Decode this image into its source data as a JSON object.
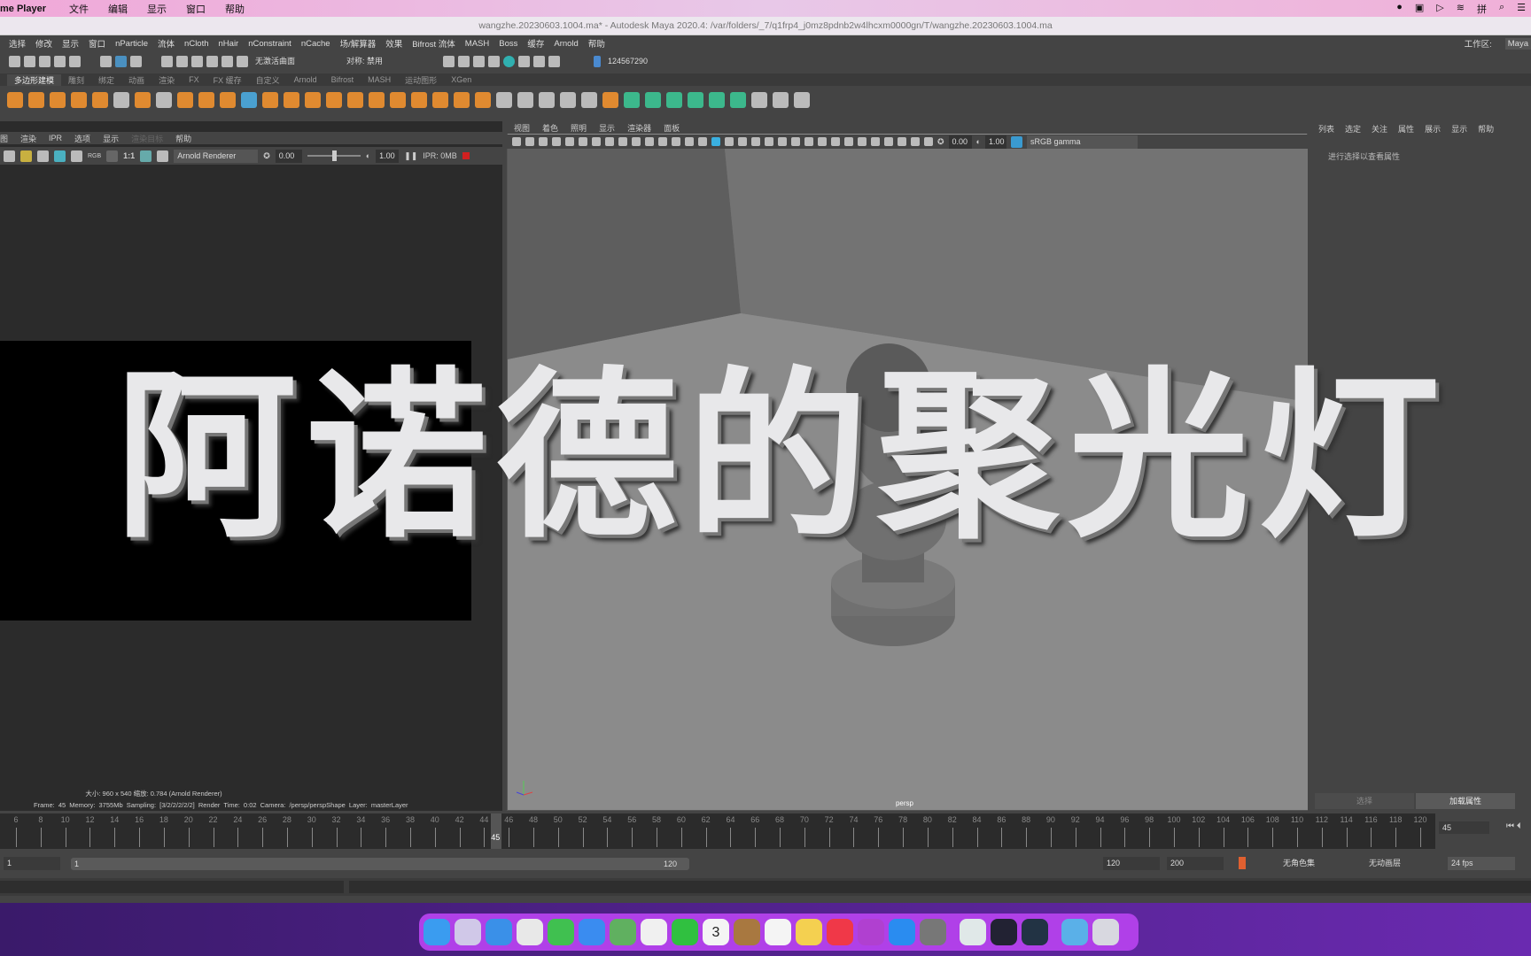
{
  "mac_menu": {
    "app": "me Player",
    "items": [
      "文件",
      "编辑",
      "显示",
      "窗口",
      "帮助"
    ]
  },
  "title": "wangzhe.20230603.1004.ma* - Autodesk Maya 2020.4: /var/folders/_7/q1frp4_j0mz8pdnb2w4lhcxm0000gn/T/wangzhe.20230603.1004.ma",
  "menus": [
    "选择",
    "修改",
    "显示",
    "窗口",
    "nParticle",
    "流体",
    "nCloth",
    "nHair",
    "nConstraint",
    "nCache",
    "场/解算器",
    "效果",
    "Bifrost 流体",
    "MASH",
    "Boss",
    "缓存",
    "Arnold",
    "帮助"
  ],
  "workspace": {
    "label": "工作区:",
    "value": "Maya"
  },
  "status": {
    "live_surface": "无激活曲面",
    "symmetry": "对称: 禁用",
    "user": "124567290"
  },
  "shelf_tabs": [
    "多边形建模",
    "雕刻",
    "绑定",
    "动画",
    "渲染",
    "FX",
    "FX 缓存",
    "自定义",
    "Arnold",
    "Bifrost",
    "MASH",
    "运动图形",
    "XGen"
  ],
  "render_view": {
    "menus": [
      "图",
      "渲染",
      "IPR",
      "选项",
      "显示",
      "渲染目标",
      "帮助"
    ],
    "ratio": "1:1",
    "rgb": "RGB",
    "renderer": "Arnold Renderer",
    "exposure": "0.00",
    "gamma": "1.00",
    "ipr": "IPR: 0MB",
    "size_info": "大小: 960 x 540  缩放: 0.784    (Arnold Renderer)",
    "info": "Frame: 45    Memory: 3755Mb    Sampling: [3/2/2/2/2/2]    Render Time: 0:02    Camera: /persp/perspShape    Layer: masterLayer"
  },
  "viewport": {
    "menus": [
      "视图",
      "着色",
      "照明",
      "显示",
      "渲染器",
      "面板"
    ],
    "exposure": "0.00",
    "gamma": "1.00",
    "color_space": "sRGB gamma",
    "camera": "persp"
  },
  "attribute_editor": {
    "menus": [
      "列表",
      "选定",
      "关注",
      "属性",
      "展示",
      "显示",
      "帮助"
    ],
    "hint": "进行选择以查看属性",
    "buttons": [
      "选择",
      "加载属性"
    ]
  },
  "timeline": {
    "ticks": [
      6,
      8,
      10,
      12,
      14,
      16,
      18,
      20,
      22,
      24,
      26,
      28,
      30,
      32,
      34,
      36,
      38,
      40,
      42,
      44,
      46,
      48,
      50,
      52,
      54,
      56,
      58,
      60,
      62,
      64,
      66,
      68,
      70,
      72,
      74,
      76,
      78,
      80,
      82,
      84,
      86,
      88,
      90,
      92,
      94,
      96,
      98,
      100,
      102,
      104,
      106,
      108,
      110,
      112,
      114,
      116,
      118,
      120
    ],
    "current": "45"
  },
  "range": {
    "start": "1",
    "inner_start": "1",
    "inner_end": "120",
    "end": "120",
    "max": "200",
    "char_set": "无角色集",
    "anim_layer": "无动画层",
    "fps": "24 fps"
  },
  "overlay_text": "阿诺德的聚光灯",
  "dock": [
    "finder",
    "launchpad",
    "safari",
    "chrome",
    "messages",
    "mail",
    "maps",
    "photos",
    "facetime",
    "calendar",
    "contacts",
    "reminders",
    "notes",
    "music",
    "podcasts",
    "app-store",
    "system-preferences",
    "maya",
    "video-player",
    "quicktime",
    "downloads",
    "trash"
  ],
  "dock_colors": [
    "#3a9cf0",
    "#d0c8e8",
    "#3a90e8",
    "#e8e8e8",
    "#40c050",
    "#3a8cf0",
    "#60b060",
    "#f0f0f0",
    "#30c040",
    "#f4f4f4",
    "#a87840",
    "#f4f4f4",
    "#f4d050",
    "#f03848",
    "#b040d0",
    "#2a8cf0",
    "#777777",
    "#e0e8e8",
    "#222233",
    "#223344",
    "#5ab0e8",
    "#d8d8e0"
  ],
  "calendar_day": "3"
}
